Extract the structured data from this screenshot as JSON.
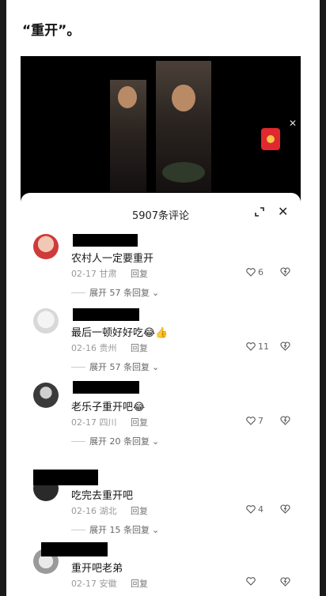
{
  "post": {
    "headline": "“重开”。"
  },
  "video": {
    "close_icon": "close-icon",
    "redpack_icon": "red-envelope-icon"
  },
  "comments_panel": {
    "title": "5907条评论",
    "expand_icon": "expand-icon",
    "close_icon": "close-icon",
    "comments": [
      {
        "text": "农村人一定要重开",
        "date": "02-17",
        "location": "甘肃",
        "reply": "回复",
        "likes": "6",
        "replies": "展开 57 条回复"
      },
      {
        "text": "最后一顿好好吃😂👍",
        "date": "02-16",
        "location": "贵州",
        "reply": "回复",
        "likes": "11",
        "replies": "展开 57 条回复"
      },
      {
        "text": "老乐子重开吧😂",
        "date": "02-17",
        "location": "四川",
        "reply": "回复",
        "likes": "7",
        "replies": "展开 20 条回复"
      },
      {
        "text": "吃完去重开吧",
        "date": "02-16",
        "location": "湖北",
        "reply": "回复",
        "likes": "4",
        "replies": "展开 15 条回复"
      },
      {
        "text": "重开吧老弟",
        "date": "02-17",
        "location": "安徽",
        "reply": "回复",
        "likes": "",
        "replies": ""
      }
    ]
  }
}
